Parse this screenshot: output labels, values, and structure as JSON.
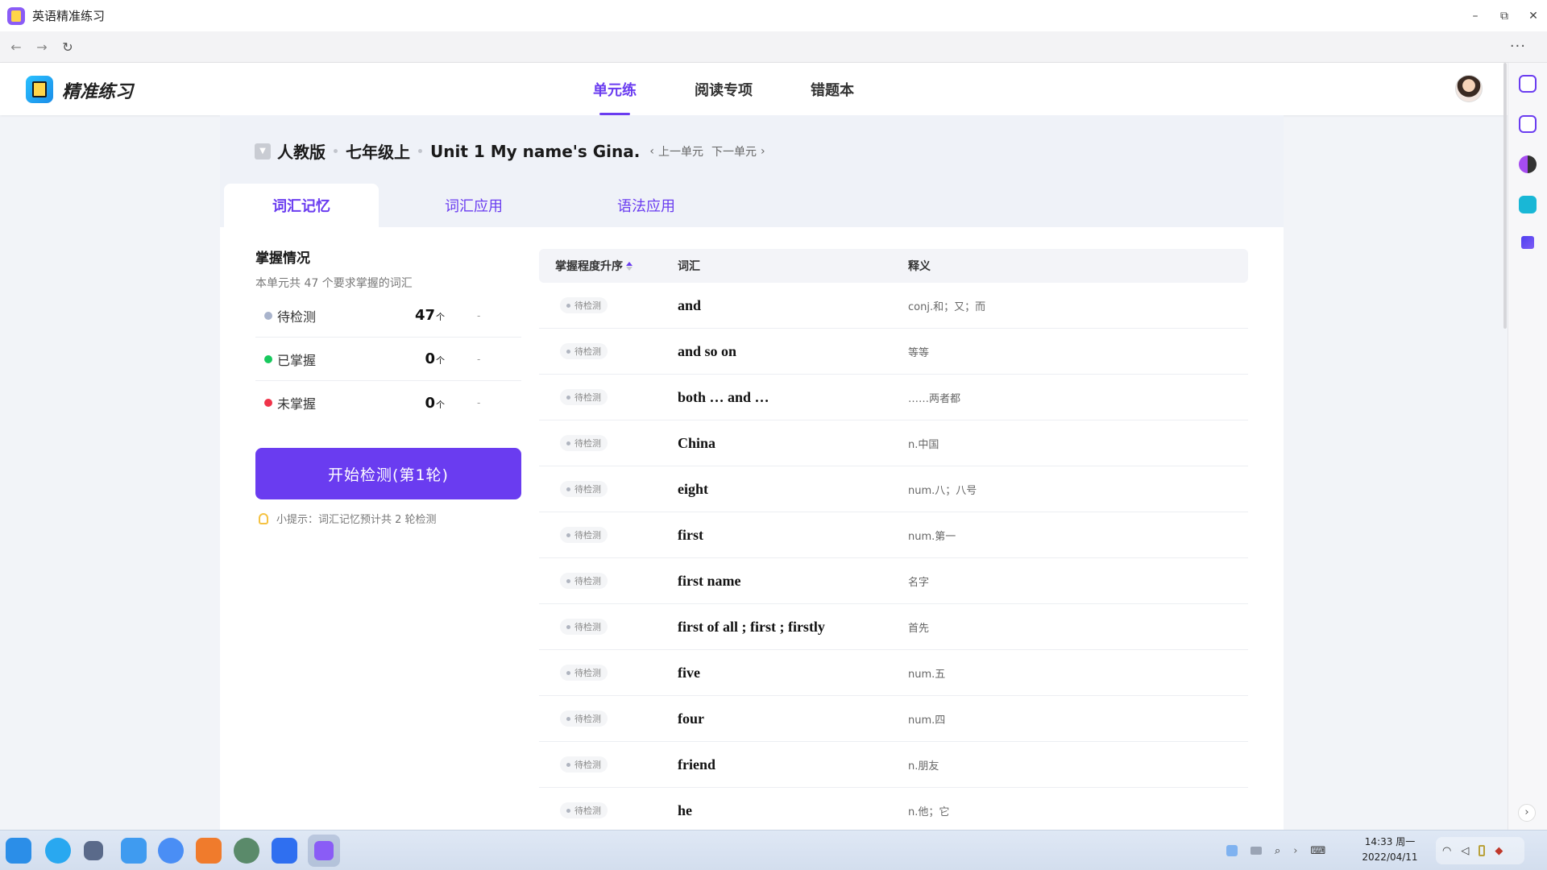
{
  "window": {
    "title": "英语精准练习",
    "minimize": "–",
    "maximize": "⧉",
    "close": "✕"
  },
  "browser": {
    "back": "←",
    "forward": "→",
    "reload": "↻",
    "more": "···"
  },
  "app": {
    "logo_text": "精准练习",
    "nav": [
      {
        "label": "单元练",
        "active": true
      },
      {
        "label": "阅读专项",
        "active": false
      },
      {
        "label": "错题本",
        "active": false
      }
    ]
  },
  "breadcrumb": {
    "items": [
      "人教版",
      "七年级上",
      "Unit 1 My name's Gina."
    ],
    "prev_unit": "上一单元",
    "next_unit": "下一单元",
    "prev_arrow": "‹",
    "next_arrow": "›"
  },
  "subtabs": [
    {
      "label": "词汇记忆",
      "active": true
    },
    {
      "label": "词汇应用",
      "active": false
    },
    {
      "label": "语法应用",
      "active": false
    }
  ],
  "summary": {
    "title": "掌握情况",
    "desc": "本单元共 47 个要求掌握的词汇",
    "unit": "个",
    "stats": [
      {
        "label": "待检测",
        "count": "47",
        "dash": "-",
        "color": "#a9b4cc"
      },
      {
        "label": "已掌握",
        "count": "0",
        "dash": "-",
        "color": "#18c95d"
      },
      {
        "label": "未掌握",
        "count": "0",
        "dash": "-",
        "color": "#f0344a"
      }
    ],
    "start_button": "开始检测(第1轮)",
    "tip": "小提示：词汇记忆预计共 2 轮检测"
  },
  "table": {
    "headers": {
      "status": "掌握程度升序",
      "word": "词汇",
      "meaning": "释义"
    },
    "rows": [
      {
        "status": "待检测",
        "word": "and",
        "meaning": "conj.和；又；而"
      },
      {
        "status": "待检测",
        "word": "and so on",
        "meaning": "等等"
      },
      {
        "status": "待检测",
        "word": "both … and …",
        "meaning": "……两者都"
      },
      {
        "status": "待检测",
        "word": "China",
        "meaning": "n.中国"
      },
      {
        "status": "待检测",
        "word": "eight",
        "meaning": "num.八；八号"
      },
      {
        "status": "待检测",
        "word": "first",
        "meaning": "num.第一"
      },
      {
        "status": "待检测",
        "word": "first name",
        "meaning": "名字"
      },
      {
        "status": "待检测",
        "word": "first of all ; first ; firstly",
        "meaning": "首先"
      },
      {
        "status": "待检测",
        "word": "five",
        "meaning": "num.五"
      },
      {
        "status": "待检测",
        "word": "four",
        "meaning": "num.四"
      },
      {
        "status": "待检测",
        "word": "friend",
        "meaning": "n.朋友"
      },
      {
        "status": "待检测",
        "word": "he",
        "meaning": "n.他；它"
      }
    ]
  },
  "taskbar": {
    "time": "14:33 周一",
    "date": "2022/04/11"
  },
  "colors": {
    "accent": "#6a3cf0",
    "panel_top": "#eff2f8"
  }
}
